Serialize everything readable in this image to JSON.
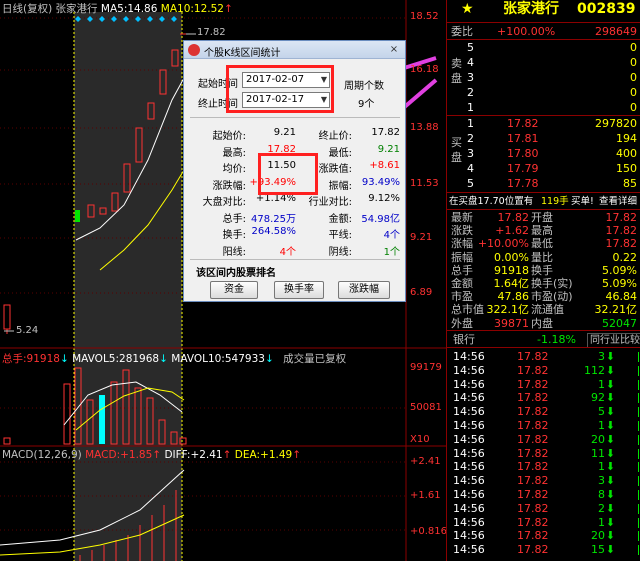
{
  "chart_header": {
    "period": "日线(复权)",
    "name": "张家港行",
    "ma5_label": "MA5:",
    "ma5_value": "14.86",
    "ma10_label": "MA10:",
    "ma10_value": "12.52"
  },
  "price_axis": [
    "18.52",
    "16.18",
    "13.88",
    "11.53",
    "9.21",
    "6.89"
  ],
  "price_marks": {
    "high": "17.82",
    "low": "5.24"
  },
  "volume_header": {
    "label": "总手:",
    "value": "91918",
    "mavol5_label": "MAVOL5:",
    "mavol5_value": "281968",
    "mavol10_label": "MAVOL10:",
    "mavol10_value": "547933",
    "note": "成交量已复权"
  },
  "volume_axis": [
    "99179",
    "50081",
    "X10"
  ],
  "macd_header": {
    "label": "MACD(12,26,9)",
    "macd_label": "MACD:",
    "macd_value": "+1.85",
    "diff_label": "DIFF:",
    "diff_value": "+2.41",
    "dea_label": "DEA:",
    "dea_value": "+1.49"
  },
  "macd_axis": [
    "+2.41",
    "+1.61",
    "+0.816"
  ],
  "dialog": {
    "title": "个股K线区间统计",
    "close": "×",
    "start_time_label": "起始时间",
    "start_time": "2017-02-07",
    "end_time_label": "终止时间",
    "end_time": "2017-02-17",
    "period_count_label": "周期个数",
    "period_count": "9个",
    "stats": [
      {
        "l1": "起始价:",
        "v1": "9.21",
        "c1": "#000000",
        "l2": "终止价:",
        "v2": "17.82",
        "c2": "#000000"
      },
      {
        "l1": "最高:",
        "v1": "17.82",
        "c1": "#ff0000",
        "l2": "最低:",
        "v2": "9.21",
        "c2": "#008000"
      },
      {
        "l1": "均价:",
        "v1": "11.50",
        "c1": "#000000",
        "l2": "涨跌值:",
        "v2": "+8.61",
        "c2": "#ff0000"
      },
      {
        "l1": "涨跌幅:",
        "v1": "+93.49%",
        "c1": "#ff0000",
        "l2": "振幅:",
        "v2": "93.49%",
        "c2": "#0000c8"
      },
      {
        "l1": "大盘对比:",
        "v1": "+1.14%",
        "c1": "#000000",
        "l2": "行业对比:",
        "v2": "9.12%",
        "c2": "#000000"
      },
      {
        "l1": "总手:",
        "v1": "478.25万",
        "c1": "#0000c8",
        "l2": "金额:",
        "v2": "54.98亿",
        "c2": "#0000c8"
      },
      {
        "l1": "换手:",
        "v1": "264.58%",
        "c1": "#0000c8",
        "l2": "平线:",
        "v2": "4个",
        "c2": "#0000c8"
      },
      {
        "l1": "阳线:",
        "v1": "4个",
        "c1": "#ff0000",
        "l2": "阴线:",
        "v2": "1个",
        "c2": "#008000"
      }
    ],
    "rank_title": "该区间内股票排名",
    "buttons": [
      "资金",
      "换手率",
      "涨跌幅"
    ]
  },
  "quote": {
    "star": "★",
    "name": "张家港行",
    "code": "002839",
    "weibi_label": "委比",
    "weibi_value": "+100.00%",
    "weicha_value": "298649",
    "sell_label": "卖盘",
    "sell": [
      {
        "level": "5",
        "price": "",
        "vol": "0"
      },
      {
        "level": "4",
        "price": "",
        "vol": "0"
      },
      {
        "level": "3",
        "price": "",
        "vol": "0"
      },
      {
        "level": "2",
        "price": "",
        "vol": "0"
      },
      {
        "level": "1",
        "price": "",
        "vol": "0"
      }
    ],
    "buy_label": "买盘",
    "buy": [
      {
        "level": "1",
        "price": "17.82",
        "vol": "297820"
      },
      {
        "level": "2",
        "price": "17.81",
        "vol": "194"
      },
      {
        "level": "3",
        "price": "17.80",
        "vol": "400"
      },
      {
        "level": "4",
        "price": "17.79",
        "vol": "150"
      },
      {
        "level": "5",
        "price": "17.78",
        "vol": "85"
      }
    ],
    "banner_a": "在买盘17.70位置有",
    "banner_b": "119手",
    "banner_c": "买单!",
    "banner_d": "查看详细",
    "stats": [
      {
        "l1": "最新",
        "v1": "17.82",
        "l2": "开盘",
        "v2": "17.82"
      },
      {
        "l1": "涨跌",
        "v1": "+1.62",
        "l2": "最高",
        "v2": "17.82"
      },
      {
        "l1": "涨幅",
        "v1": "+10.00%",
        "l2": "最低",
        "v2": "17.82"
      },
      {
        "l1": "振幅",
        "v1": "0.00%",
        "l2": "量比",
        "v2": "0.22"
      },
      {
        "l1": "总手",
        "v1": "91918",
        "l2": "换手",
        "v2": "5.09%"
      },
      {
        "l1": "金额",
        "v1": "1.64亿",
        "l2": "换手(实)",
        "v2": "5.09%"
      },
      {
        "l1": "市盈",
        "v1": "47.86",
        "l2": "市盈(动)",
        "v2": "46.84"
      },
      {
        "l1": "总市值",
        "v1": "322.1亿",
        "l2": "流通值",
        "v2": "32.21亿"
      },
      {
        "l1": "外盘",
        "v1": "39871",
        "l2": "内盘",
        "v2": "52047"
      }
    ],
    "industry": "银行",
    "industry_change": "-1.18%",
    "industry_btn": "同行业比较",
    "ticks": [
      {
        "time": "14:56",
        "price": "17.82",
        "vol": "3"
      },
      {
        "time": "14:56",
        "price": "17.82",
        "vol": "112"
      },
      {
        "time": "14:56",
        "price": "17.82",
        "vol": "1"
      },
      {
        "time": "14:56",
        "price": "17.82",
        "vol": "92"
      },
      {
        "time": "14:56",
        "price": "17.82",
        "vol": "5"
      },
      {
        "time": "14:56",
        "price": "17.82",
        "vol": "1"
      },
      {
        "time": "14:56",
        "price": "17.82",
        "vol": "20"
      },
      {
        "time": "14:56",
        "price": "17.82",
        "vol": "11"
      },
      {
        "time": "14:56",
        "price": "17.82",
        "vol": "1"
      },
      {
        "time": "14:56",
        "price": "17.82",
        "vol": "3"
      },
      {
        "time": "14:56",
        "price": "17.82",
        "vol": "8"
      },
      {
        "time": "14:56",
        "price": "17.82",
        "vol": "2"
      },
      {
        "time": "14:56",
        "price": "17.82",
        "vol": "1"
      },
      {
        "time": "14:56",
        "price": "17.82",
        "vol": "20"
      },
      {
        "time": "14:56",
        "price": "17.82",
        "vol": "15"
      }
    ]
  },
  "colors": {
    "up": "#ff3232",
    "down": "#00e600",
    "accent": "#ffff00",
    "highlight": "#ff2020",
    "arrow": "#e040e0"
  }
}
